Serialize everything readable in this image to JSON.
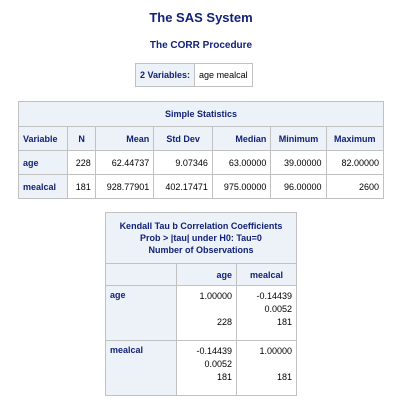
{
  "header": {
    "title": "The SAS System",
    "procedure": "The CORR Procedure"
  },
  "variables": {
    "label": "2 Variables:",
    "value": "age mealcal"
  },
  "simple_statistics": {
    "caption": "Simple Statistics",
    "columns": [
      "Variable",
      "N",
      "Mean",
      "Std Dev",
      "Median",
      "Minimum",
      "Maximum"
    ],
    "rows": [
      [
        "age",
        "228",
        "62.44737",
        "9.07346",
        "63.00000",
        "39.00000",
        "82.00000"
      ],
      [
        "mealcal",
        "181",
        "928.77901",
        "402.17471",
        "975.00000",
        "96.00000",
        "2600"
      ]
    ]
  },
  "kendall": {
    "caption": {
      "line1": "Kendall Tau b Correlation Coefficients",
      "line2": "Prob > |tau| under H0: Tau=0",
      "line3": "Number of Observations"
    },
    "columns": [
      "",
      "age",
      "mealcal"
    ],
    "rows": [
      {
        "label": "age",
        "age": {
          "coef": "1.00000",
          "p": "",
          "n": "228"
        },
        "mealcal": {
          "coef": "-0.14439",
          "p": "0.0052",
          "n": "181"
        }
      },
      {
        "label": "mealcal",
        "age": {
          "coef": "-0.14439",
          "p": "0.0052",
          "n": "181"
        },
        "mealcal": {
          "coef": "1.00000",
          "p": "",
          "n": "181"
        }
      }
    ]
  }
}
